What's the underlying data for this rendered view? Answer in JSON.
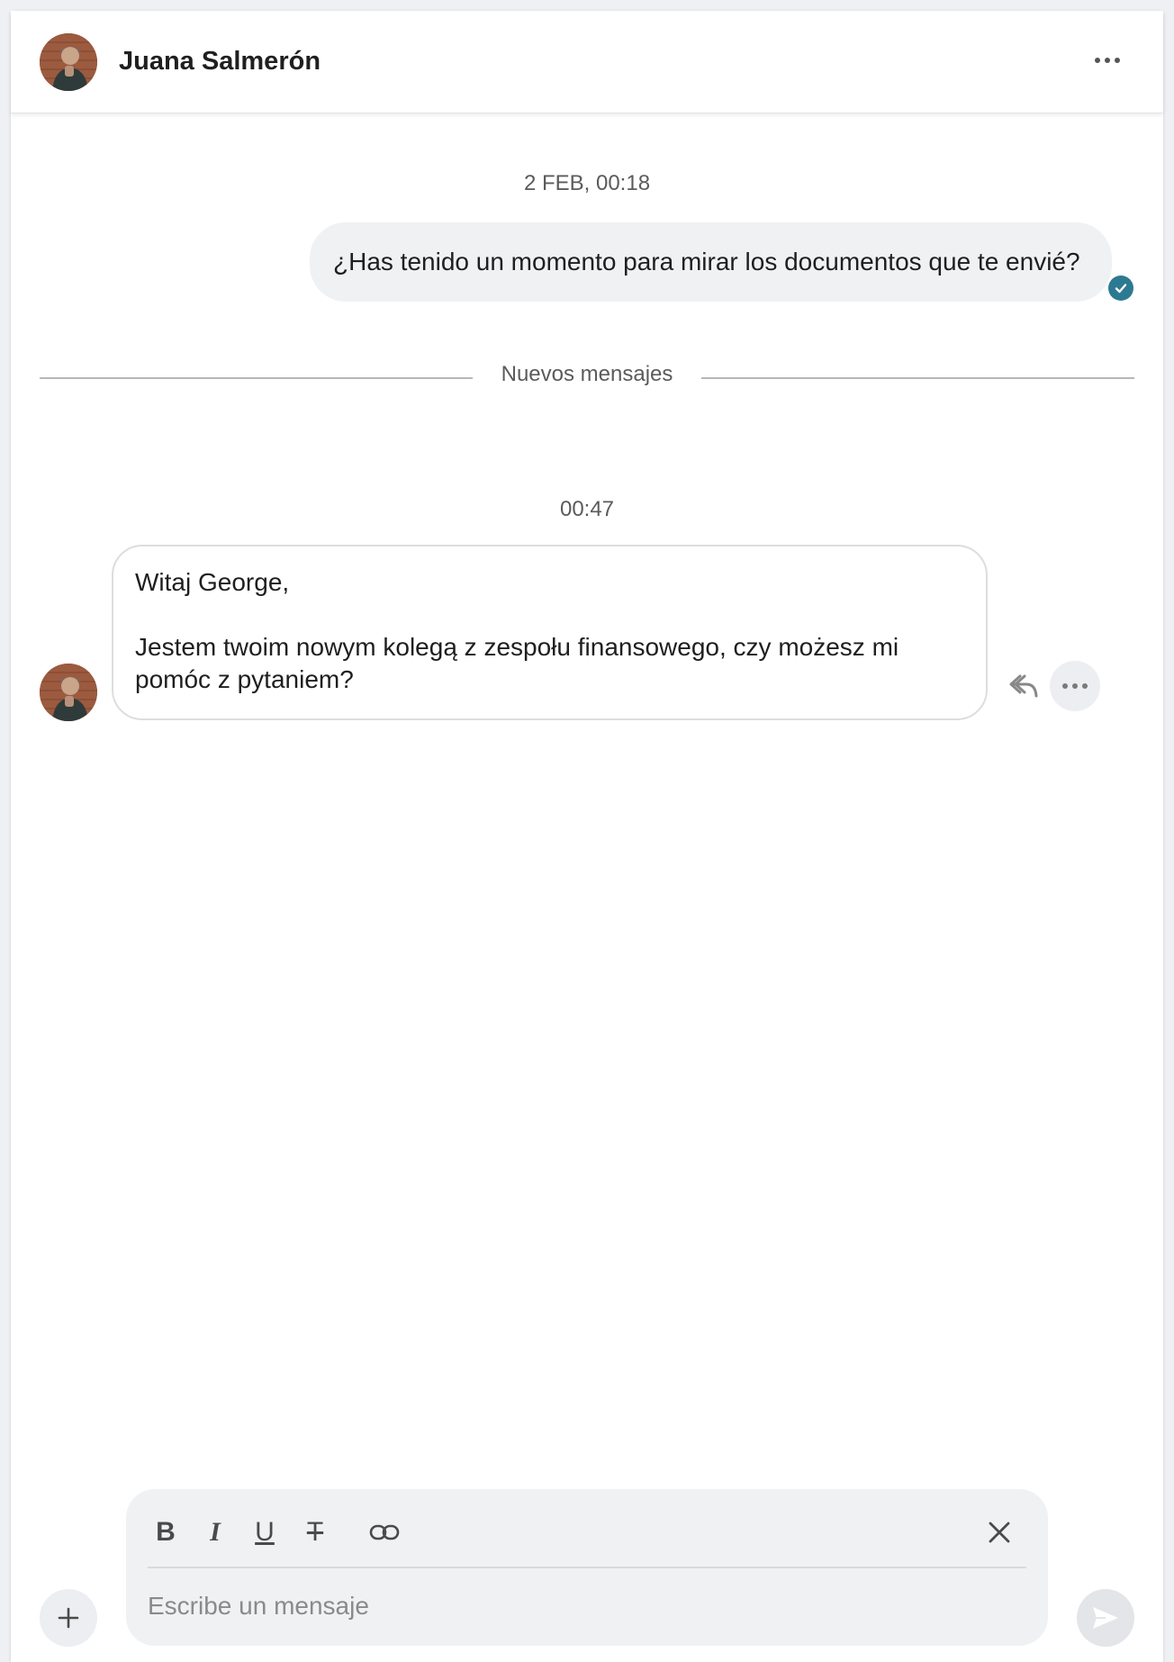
{
  "header": {
    "contact_name": "Juana Salmerón",
    "avatar_icon": "user-photo-avatar",
    "more_icon": "ellipsis-icon"
  },
  "conversation": {
    "outgoing_timestamp": "2 FEB, 00:18",
    "outgoing_message": "¿Has tenido un momento para mirar los documentos que te envié?",
    "outgoing_status_icon": "read-check-icon",
    "new_messages_label": "Nuevos mensajes",
    "incoming_timestamp": "00:47",
    "incoming_lines": [
      "Witaj George,",
      "Jestem twoim nowym kolegą z zespołu finansowego, czy możesz mi",
      "pomóc z pytaniem?"
    ],
    "reply_icon": "reply-icon",
    "more_icon": "ellipsis-icon"
  },
  "composer": {
    "toolbar": {
      "bold": "B",
      "italic": "I",
      "underline": "U",
      "strikethrough": "T",
      "link_icon": "link-icon",
      "close_icon": "close-icon"
    },
    "placeholder": "Escribe un mensaje",
    "add_icon": "plus-icon",
    "send_icon": "send-icon"
  },
  "colors": {
    "accent_check": "#2c7a91",
    "bubble_out": "#f0f1f3",
    "bubble_in_border": "#dcdde0",
    "composer_bg": "#f0f1f3"
  }
}
